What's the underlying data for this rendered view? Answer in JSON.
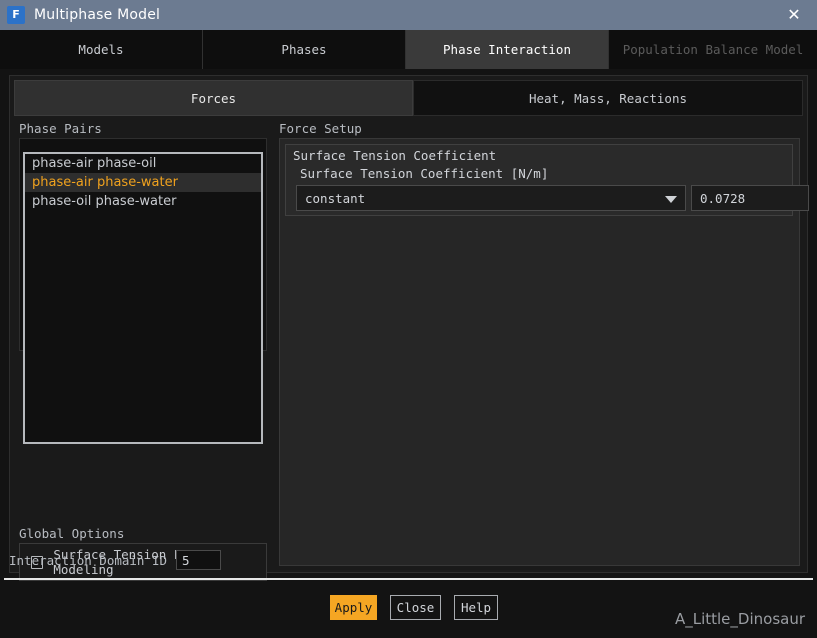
{
  "window": {
    "title": "Multiphase Model",
    "icon": "fluent-F-icon",
    "close_label": "✕"
  },
  "tabs": [
    {
      "label": "Models",
      "state": "normal"
    },
    {
      "label": "Phases",
      "state": "normal"
    },
    {
      "label": "Phase Interaction",
      "state": "active"
    },
    {
      "label": "Population Balance Model",
      "state": "disabled"
    }
  ],
  "subtabs": [
    {
      "label": "Forces",
      "state": "active"
    },
    {
      "label": "Heat, Mass, Reactions",
      "state": "normal"
    }
  ],
  "phase_pairs": {
    "group_label": "Phase Pairs",
    "items": [
      {
        "label": "phase-air phase-oil",
        "selected": false
      },
      {
        "label": "phase-air phase-water",
        "selected": true
      },
      {
        "label": "phase-oil phase-water",
        "selected": false
      }
    ]
  },
  "global_options": {
    "group_label": "Global Options",
    "checkbox_label": "Surface Tension Force Modeling",
    "checked": false
  },
  "force_setup": {
    "group_label": "Force Setup",
    "section_title": "Surface Tension Coefficient",
    "field_label": "Surface Tension Coefficient [N/m]",
    "method_value": "constant",
    "method_options": [
      "constant"
    ],
    "coefficient_value": "0.0728"
  },
  "domain": {
    "label": "Interaction Domain ID",
    "value": "5"
  },
  "buttons": {
    "apply": "Apply",
    "close": "Close",
    "help": "Help"
  },
  "watermark": "A_Little_Dinosaur",
  "colors": {
    "titlebar": "#6c7b91",
    "accent": "#f5a623",
    "selected_text": "#f0a21e",
    "panel_bg": "#1a1a1a",
    "window_bg": "#131313"
  }
}
